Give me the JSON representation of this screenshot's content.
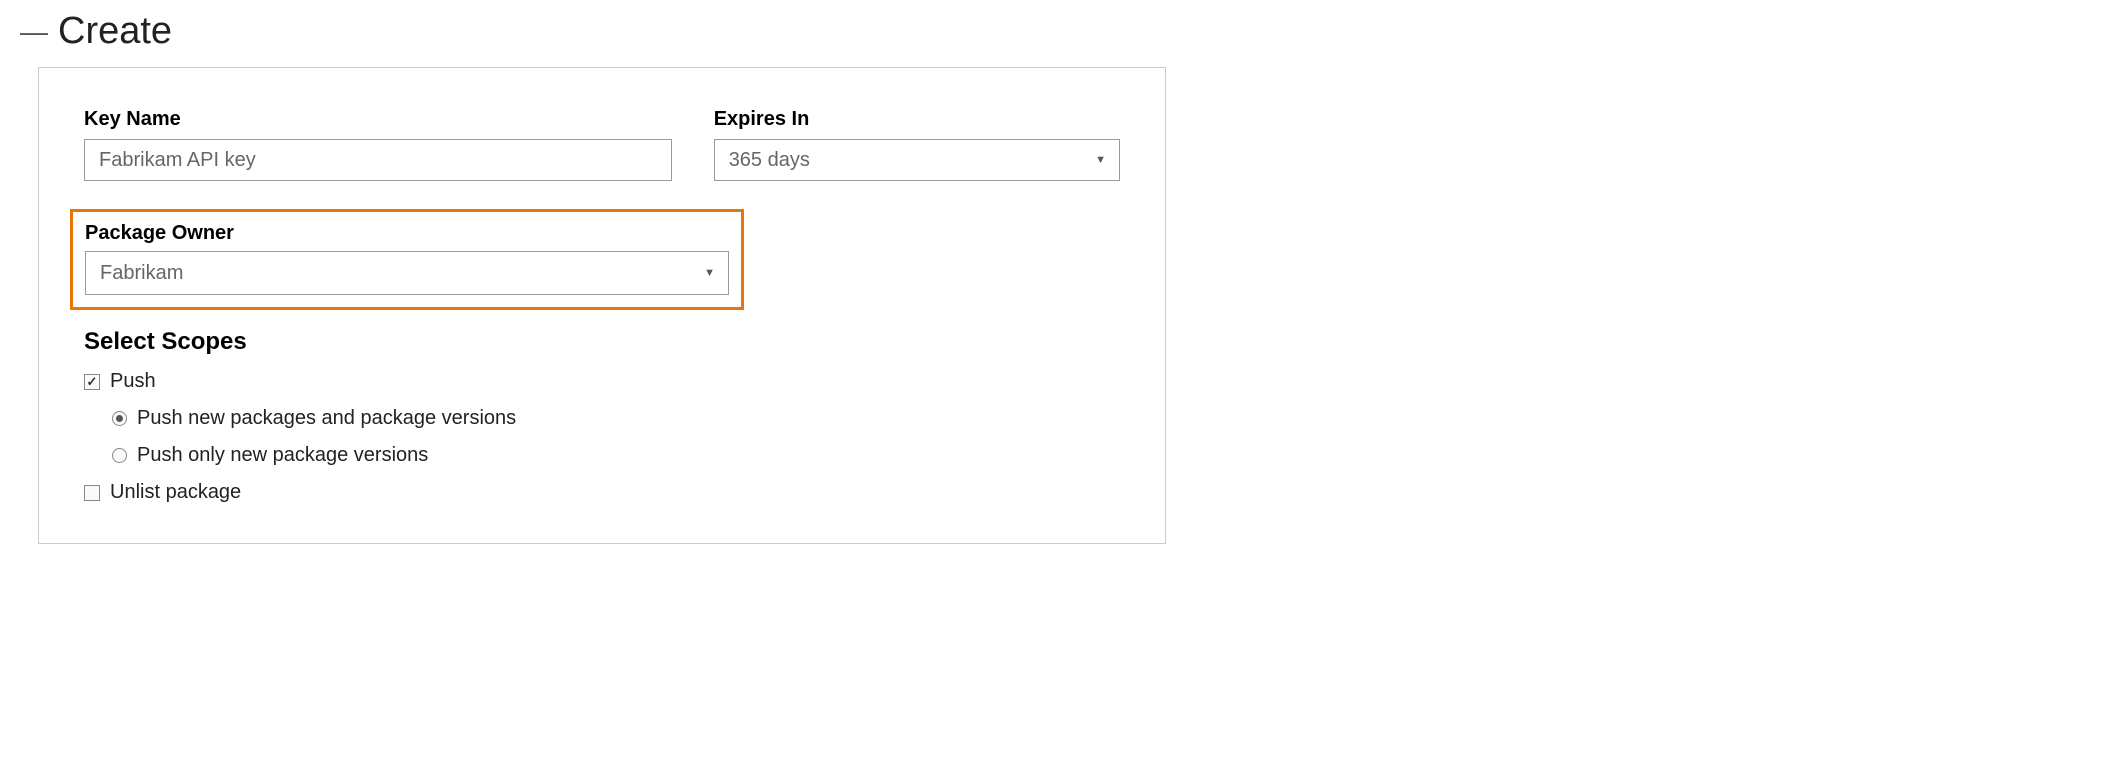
{
  "section": {
    "title": "Create"
  },
  "form": {
    "keyName": {
      "label": "Key Name",
      "value": "Fabrikam API key"
    },
    "expiresIn": {
      "label": "Expires In",
      "value": "365 days"
    },
    "packageOwner": {
      "label": "Package Owner",
      "value": "Fabrikam"
    }
  },
  "scopes": {
    "title": "Select Scopes",
    "push": {
      "label": "Push",
      "options": {
        "new_and_versions": "Push new packages and package versions",
        "versions_only": "Push only new package versions"
      }
    },
    "unlist": {
      "label": "Unlist package"
    }
  }
}
